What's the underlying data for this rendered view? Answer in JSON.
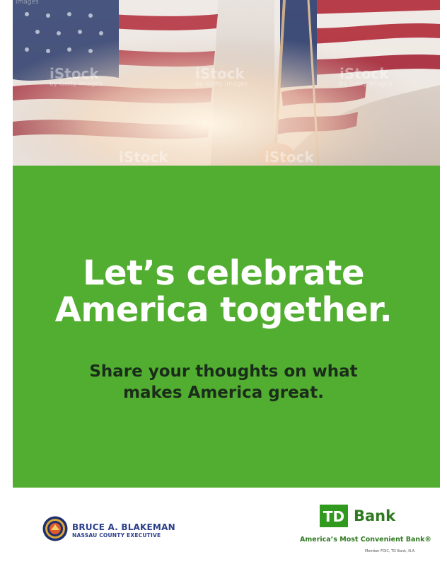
{
  "hero": {
    "watermark_brand": "iStock",
    "watermark_credit": "by Getty Images",
    "watermark_corner": "images"
  },
  "headline": {
    "line1": "Let’s celebrate",
    "line2": "America together."
  },
  "subhead": {
    "line1": "Share your thoughts on what",
    "line2": "makes America great."
  },
  "county": {
    "name": "BRUCE A. BLAKEMAN",
    "title": "NASSAU COUNTY EXECUTIVE"
  },
  "td": {
    "logo_text": "TD",
    "bank_label": "Bank",
    "tagline": "America’s Most Convenient Bank®",
    "member_note": "Member FDIC, TD Bank, N.A."
  },
  "colors": {
    "green": "#52ae30",
    "td_green": "#2f7a1f",
    "county_blue": "#2b3e8a"
  }
}
